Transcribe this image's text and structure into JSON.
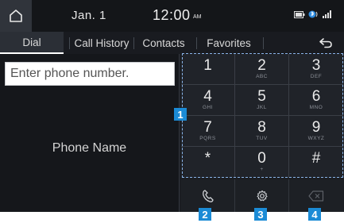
{
  "status": {
    "date": "Jan.  1",
    "time": "12:00",
    "ampm": "AM"
  },
  "tabs": [
    {
      "label": "Dial",
      "active": true
    },
    {
      "label": "Call History",
      "active": false
    },
    {
      "label": "Contacts",
      "active": false
    },
    {
      "label": "Favorites",
      "active": false
    }
  ],
  "left": {
    "phone_placeholder": "Enter phone number.",
    "phone_name": "Phone Name"
  },
  "keypad": {
    "keys": [
      {
        "digit": "1",
        "letters": ""
      },
      {
        "digit": "2",
        "letters": "ABC"
      },
      {
        "digit": "3",
        "letters": "DEF"
      },
      {
        "digit": "4",
        "letters": "GHI"
      },
      {
        "digit": "5",
        "letters": "JKL"
      },
      {
        "digit": "6",
        "letters": "MNO"
      },
      {
        "digit": "7",
        "letters": "PQRS"
      },
      {
        "digit": "8",
        "letters": "TUV"
      },
      {
        "digit": "9",
        "letters": "WXYZ"
      },
      {
        "digit": "*",
        "letters": ""
      },
      {
        "digit": "0",
        "letters": "+"
      },
      {
        "digit": "#",
        "letters": ""
      }
    ]
  },
  "actions": {
    "call_icon": "phone-handset-icon",
    "settings_icon": "gear-icon",
    "delete_icon": "backspace-icon"
  },
  "callouts": [
    "1",
    "2",
    "3",
    "4"
  ],
  "colors": {
    "callout": "#1b8bd6",
    "keypad_outline": "#8ab4e8",
    "background": "#1b1d22"
  }
}
